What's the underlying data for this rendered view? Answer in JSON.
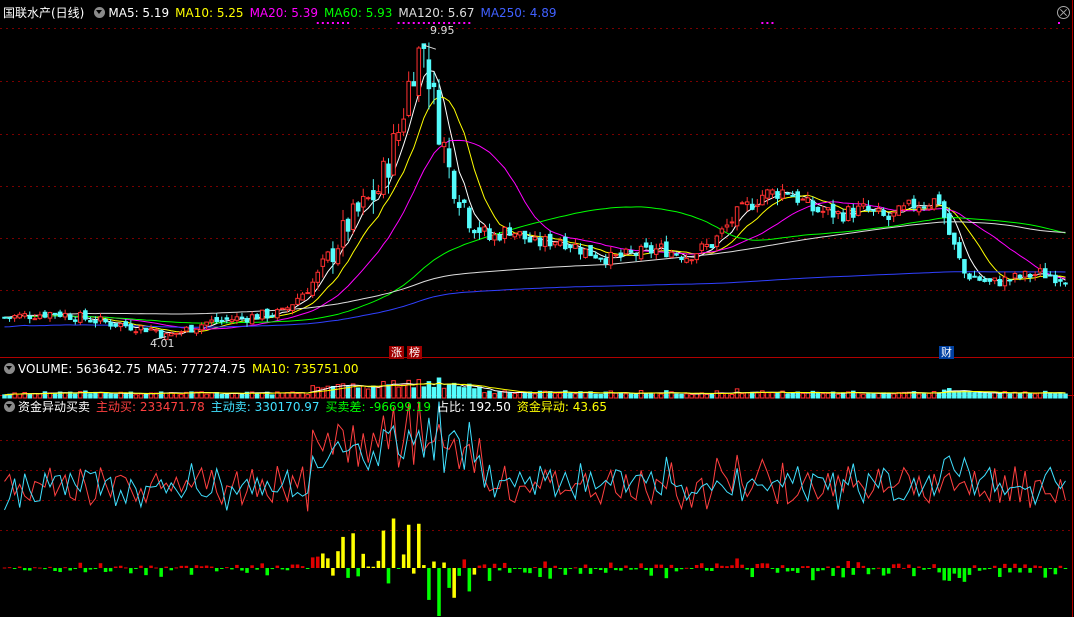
{
  "price_panel": {
    "stock_name": "国联水产(日线)",
    "ma_labels": [
      {
        "text": "MA5: 5.19",
        "color": "#ffffff"
      },
      {
        "text": "MA10: 5.25",
        "color": "#ffff00"
      },
      {
        "text": "MA20: 5.39",
        "color": "#ff00ff"
      },
      {
        "text": "MA60: 5.93",
        "color": "#00ff00"
      },
      {
        "text": "MA120: 5.67",
        "color": "#dddddd"
      },
      {
        "text": "MA250: 4.89",
        "color": "#4060ff"
      }
    ],
    "high_label": "9.95",
    "low_label": "4.01",
    "event_tag_1": "涨",
    "event_tag_2": "榜",
    "event_tag_3": "财"
  },
  "volume_panel": {
    "labels": [
      {
        "text": "VOLUME: 563642.75",
        "color": "#ffffff"
      },
      {
        "text": "MA5: 777274.75",
        "color": "#ffffff"
      },
      {
        "text": "MA10: 735751.00",
        "color": "#ffff00"
      }
    ]
  },
  "fund_panel": {
    "title": "资金异动买卖",
    "labels": [
      {
        "text": "主动买: 233471.78",
        "color": "#ff4040"
      },
      {
        "text": "主动卖: 330170.97",
        "color": "#40e0ff"
      },
      {
        "text": "买卖差: -96699.19",
        "color": "#00ff00"
      },
      {
        "text": "占比: 192.50",
        "color": "#ffffff"
      },
      {
        "text": "资金异动: 43.65",
        "color": "#ffff00"
      }
    ]
  },
  "colors": {
    "up": "#ff3030",
    "down": "#54fcfc",
    "grid": "#7a0000",
    "ma5": "#ffffff",
    "ma10": "#ffff00",
    "ma20": "#ff00ff",
    "ma60": "#00ff00",
    "ma120": "#dddddd",
    "ma250": "#3040ff"
  },
  "chart_data": {
    "type": "candlestick",
    "price_keypoints": [
      [
        0,
        4.4
      ],
      [
        10,
        4.5
      ],
      [
        20,
        4.3
      ],
      [
        30,
        4.15
      ],
      [
        32,
        4.01
      ],
      [
        40,
        4.3
      ],
      [
        55,
        4.5
      ],
      [
        62,
        5.2
      ],
      [
        68,
        6.3
      ],
      [
        74,
        7.0
      ],
      [
        78,
        8.2
      ],
      [
        81,
        9.6
      ],
      [
        83,
        9.95
      ],
      [
        85,
        8.8
      ],
      [
        88,
        7.4
      ],
      [
        92,
        6.5
      ],
      [
        96,
        6.0
      ],
      [
        100,
        6.2
      ],
      [
        105,
        5.9
      ],
      [
        110,
        6.0
      ],
      [
        115,
        5.75
      ],
      [
        120,
        5.6
      ],
      [
        125,
        5.7
      ],
      [
        130,
        5.8
      ],
      [
        135,
        5.65
      ],
      [
        140,
        5.9
      ],
      [
        145,
        6.5
      ],
      [
        150,
        6.9
      ],
      [
        155,
        7.0
      ],
      [
        160,
        6.6
      ],
      [
        165,
        6.5
      ],
      [
        170,
        6.6
      ],
      [
        175,
        6.4
      ],
      [
        180,
        6.7
      ],
      [
        185,
        6.8
      ],
      [
        187,
        6.1
      ],
      [
        190,
        5.3
      ],
      [
        195,
        5.1
      ],
      [
        200,
        5.2
      ],
      [
        205,
        5.3
      ],
      [
        210,
        5.2
      ]
    ],
    "num_days": 211,
    "price_high": 9.95,
    "price_low": 4.01,
    "ma_periods": [
      5,
      10,
      20,
      60,
      120,
      250
    ]
  }
}
